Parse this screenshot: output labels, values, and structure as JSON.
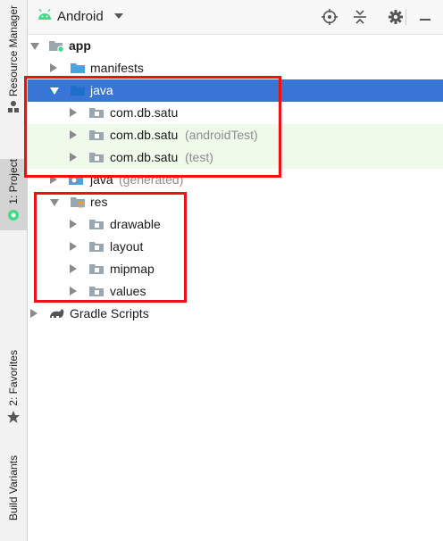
{
  "sidebar": {
    "resource_manager": "Resource Manager",
    "project": "1: Project",
    "favorites": "2: Favorites",
    "build_variants": "Build Variants"
  },
  "toolbar": {
    "title": "Android"
  },
  "tree": {
    "app": "app",
    "manifests": "manifests",
    "java": "java",
    "pkg_main": "com.db.satu",
    "pkg_android_test": "com.db.satu",
    "pkg_android_test_suffix": "(androidTest)",
    "pkg_test": "com.db.satu",
    "pkg_test_suffix": "(test)",
    "java_generated": "java",
    "java_generated_suffix": "(generated)",
    "res": "res",
    "drawable": "drawable",
    "layout": "layout",
    "mipmap": "mipmap",
    "values": "values",
    "gradle_scripts": "Gradle Scripts"
  },
  "colors": {
    "selection": "#3875d7",
    "test_background": "#effaeb",
    "highlight_box": "#ee1111",
    "folder_blue": "#4aa3df",
    "folder_gray": "#9aa7b1"
  }
}
